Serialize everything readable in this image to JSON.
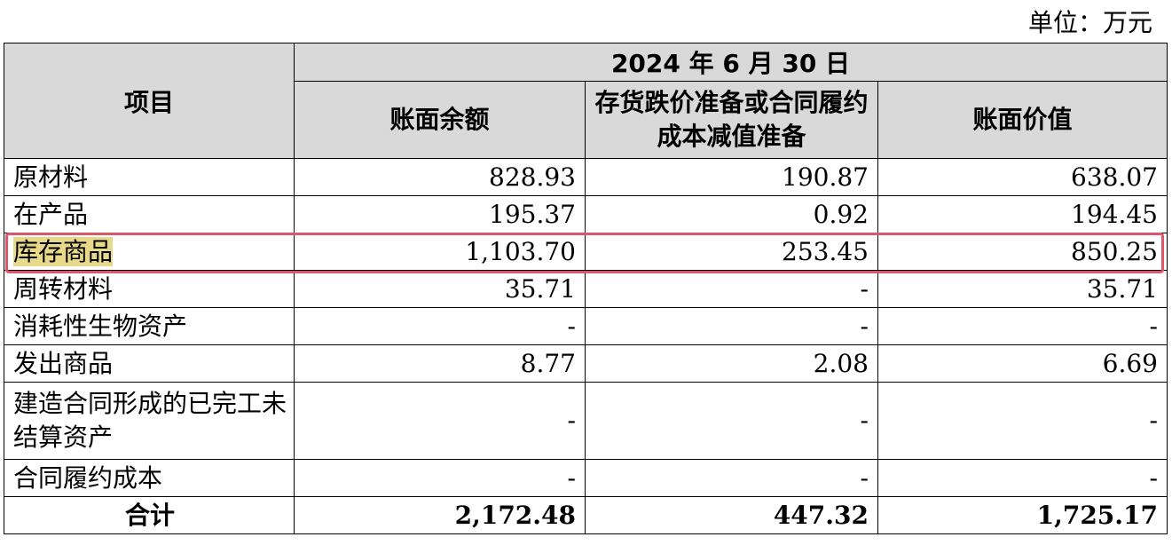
{
  "unit_label": "单位：万元",
  "header": {
    "item": "项目",
    "date": "2024 年 6 月 30 日",
    "cols": [
      "账面余额",
      "存货跌价准备或合同履约成本减值准备",
      "账面价值"
    ]
  },
  "rows": [
    {
      "label": "原材料",
      "balance": "828.93",
      "provision": "190.87",
      "value": "638.07"
    },
    {
      "label": "在产品",
      "balance": "195.37",
      "provision": "0.92",
      "value": "194.45"
    },
    {
      "label": "库存商品",
      "balance": "1,103.70",
      "provision": "253.45",
      "value": "850.25"
    },
    {
      "label": "周转材料",
      "balance": "35.71",
      "provision": "-",
      "value": "35.71"
    },
    {
      "label": "消耗性生物资产",
      "balance": "-",
      "provision": "-",
      "value": "-"
    },
    {
      "label": "发出商品",
      "balance": "8.77",
      "provision": "2.08",
      "value": "6.69"
    },
    {
      "label": "建造合同形成的已完工未结算资产",
      "balance": "-",
      "provision": "-",
      "value": "-"
    },
    {
      "label": "合同履约成本",
      "balance": "-",
      "provision": "-",
      "value": "-"
    }
  ],
  "total": {
    "label": "合计",
    "balance": "2,172.48",
    "provision": "447.32",
    "value": "1,725.17"
  },
  "highlight_color": "#e0556a"
}
